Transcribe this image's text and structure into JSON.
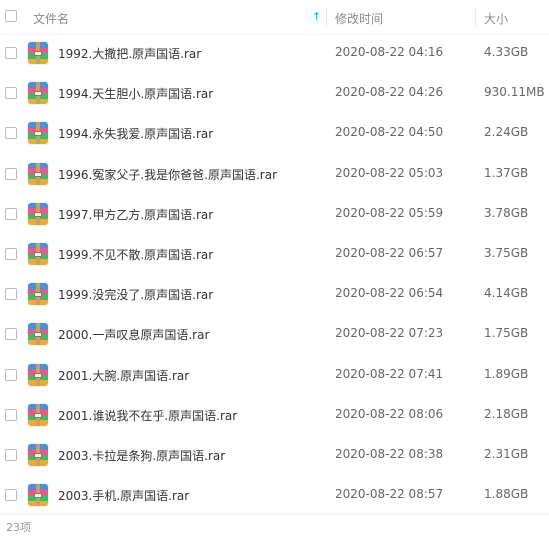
{
  "header": {
    "name_label": "文件名",
    "date_label": "修改时间",
    "size_label": "大小",
    "sort_indicator": "↑"
  },
  "files": [
    {
      "name": "1992.大撒把.原声国语.rar",
      "modified": "2020-08-22 04:16",
      "size": "4.33GB"
    },
    {
      "name": "1994.天生胆小.原声国语.rar",
      "modified": "2020-08-22 04:26",
      "size": "930.11MB"
    },
    {
      "name": "1994.永失我爱.原声国语.rar",
      "modified": "2020-08-22 04:50",
      "size": "2.24GB"
    },
    {
      "name": "1996.冤家父子.我是你爸爸.原声国语.rar",
      "modified": "2020-08-22 05:03",
      "size": "1.37GB"
    },
    {
      "name": "1997.甲方乙方.原声国语.rar",
      "modified": "2020-08-22 05:59",
      "size": "3.78GB"
    },
    {
      "name": "1999.不见不散.原声国语.rar",
      "modified": "2020-08-22 06:57",
      "size": "3.75GB"
    },
    {
      "name": "1999.没完没了.原声国语.rar",
      "modified": "2020-08-22 06:54",
      "size": "4.14GB"
    },
    {
      "name": "2000.一声叹息原声国语.rar",
      "modified": "2020-08-22 07:23",
      "size": "1.75GB"
    },
    {
      "name": "2001.大腕.原声国语.rar",
      "modified": "2020-08-22 07:41",
      "size": "1.89GB"
    },
    {
      "name": "2001.谁说我不在乎.原声国语.rar",
      "modified": "2020-08-22 08:06",
      "size": "2.18GB"
    },
    {
      "name": "2003.卡拉是条狗.原声国语.rar",
      "modified": "2020-08-22 08:38",
      "size": "2.31GB"
    },
    {
      "name": "2003.手机.原声国语.rar",
      "modified": "2020-08-22 08:57",
      "size": "1.88GB"
    }
  ],
  "footer": {
    "item_count": "23项"
  },
  "colors": {
    "accent": "#09aaff",
    "header_text": "#8a8a8a",
    "file_text": "#333333",
    "meta_text": "#666666"
  },
  "icons": {
    "file": "rar-archive-icon",
    "sort": "sort-ascending-icon"
  }
}
